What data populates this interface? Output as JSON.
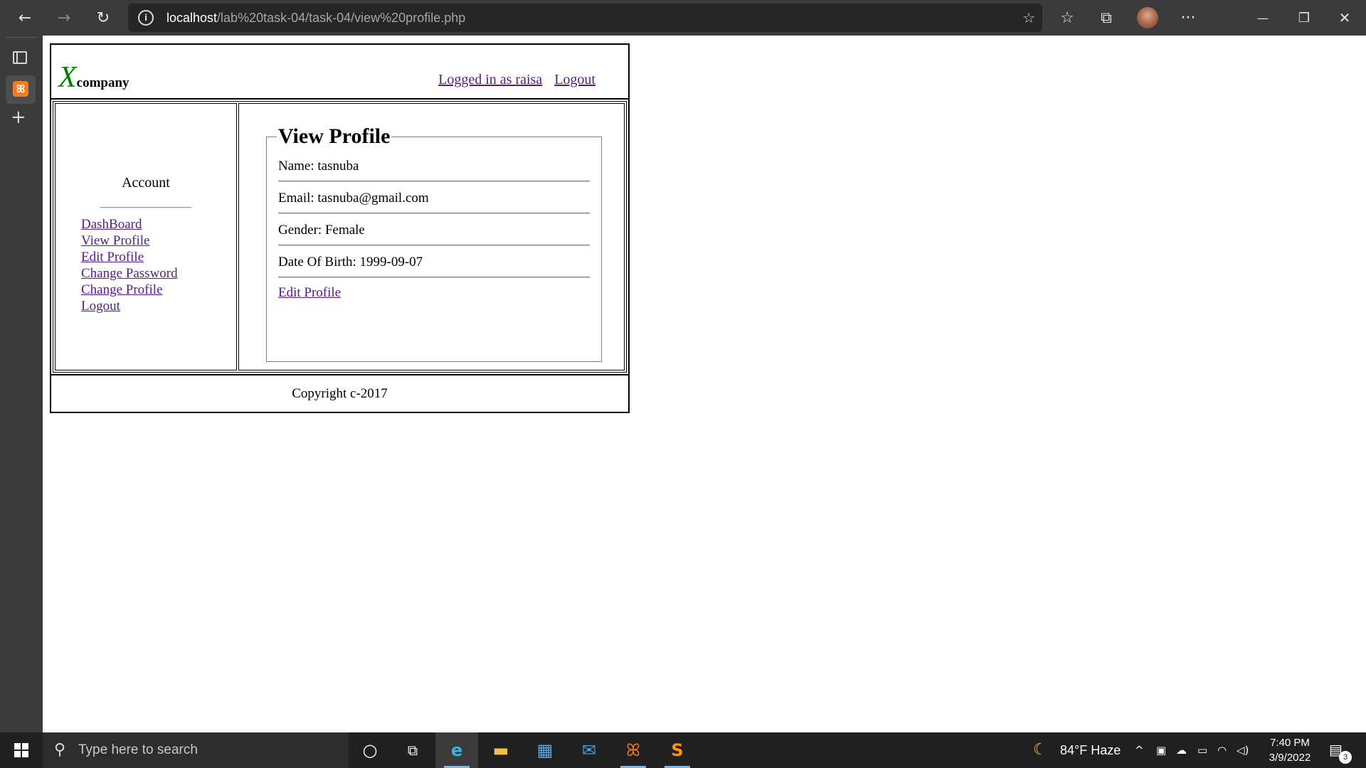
{
  "browser": {
    "url_host": "localhost",
    "url_path": "/lab%20task-04/task-04/view%20profile.php",
    "icons": {
      "back": "back-arrow-icon",
      "forward": "forward-arrow-icon",
      "refresh": "refresh-icon",
      "info": "info-icon",
      "add_favorite": "add-favorite-icon",
      "favorites": "favorites-icon",
      "collections": "collections-icon",
      "profile": "profile-avatar",
      "more": "more-options-icon",
      "minimize": "minimize-icon",
      "restore": "restore-icon",
      "close": "close-icon"
    },
    "glyphs": {
      "back": "←",
      "forward": "→",
      "refresh": "↻",
      "info": "i",
      "add_favorite": "☆",
      "favorites": "☆",
      "collections": "⧉",
      "more": "···",
      "minimize": "—",
      "restore": "❐",
      "close": "✕",
      "new_tab": "+",
      "xampp": "ꕤ"
    }
  },
  "header": {
    "logo_x": "X",
    "logo_company": "company",
    "logged_in_label": "Logged in as raisa",
    "logout_label": "Logout"
  },
  "account": {
    "title": "Account",
    "links": [
      "DashBoard",
      "View Profile",
      "Edit Profile",
      "Change Password",
      "Change Profile",
      "Logout"
    ]
  },
  "profile": {
    "legend": "View Profile",
    "name": "Name: tasnuba",
    "email": "Email: tasnuba@gmail.com",
    "gender": "Gender: Female",
    "dob": "Date Of Birth: 1999-09-07",
    "edit_link": "Edit Profile"
  },
  "footer": {
    "copyright": "Copyright c-2017"
  },
  "taskbar": {
    "search_placeholder": "Type here to search",
    "weather": "84°F  Haze",
    "time": "7:40 PM",
    "date": "3/9/2022",
    "notification_count": "3",
    "glyphs": {
      "search": "⚲",
      "cortana": "○",
      "task_view": "⧉",
      "edge": "e",
      "explorer": "▬",
      "store": "▦",
      "mail": "✉",
      "xampp": "ꕤ",
      "sublime": "S",
      "weather": "☾",
      "chevron": "^",
      "meet": "▣",
      "cloud": "☁",
      "battery": "▭",
      "wifi": "◠",
      "volume": "◁)",
      "notification": "▤"
    }
  },
  "colors": {
    "browser_chrome": "#3b3b3b",
    "logo_x": "#008000",
    "link_visited": "#551a8b",
    "taskbar": "#202020",
    "xampp_orange": "#fb7a24"
  }
}
